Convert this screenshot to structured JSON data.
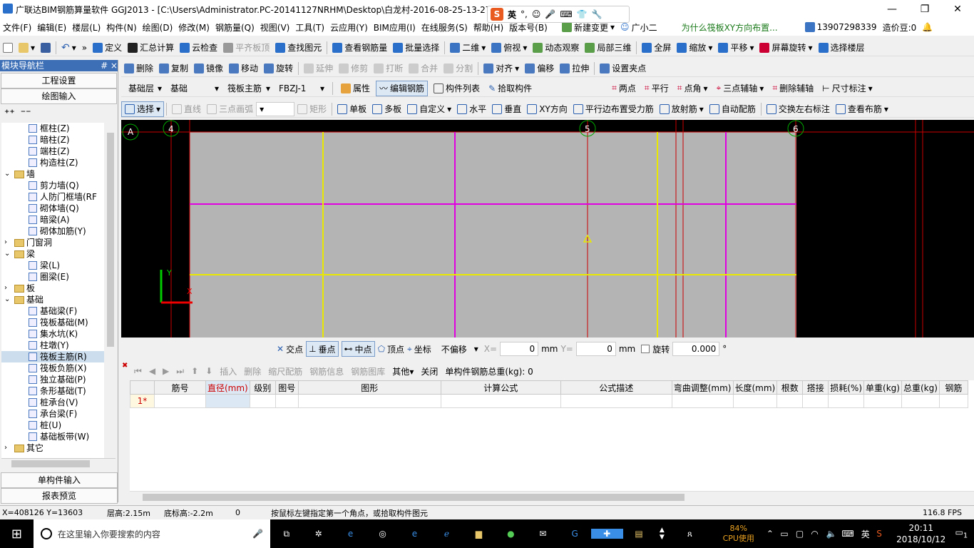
{
  "title": "广联达BIM钢筋算量软件 GGJ2013 - [C:\\Users\\Administrator.PC-20141127NRHM\\Desktop\\白龙村-2016-08-25-13-27",
  "ime": {
    "lang": "英"
  },
  "menu": [
    "文件(F)",
    "编辑(E)",
    "楼层(L)",
    "构件(N)",
    "绘图(D)",
    "修改(M)",
    "钢筋量(Q)",
    "视图(V)",
    "工具(T)",
    "云应用(Y)",
    "BIM应用(I)",
    "在线服务(S)",
    "帮助(H)",
    "版本号(B)"
  ],
  "menu_right": {
    "new_change": "新建变更",
    "assistant": "广小二",
    "question": "为什么筏板XY方向布置...",
    "phone": "13907298339",
    "cost": "造价豆:0"
  },
  "tb1": [
    "定义",
    "汇总计算",
    "云检查",
    "平齐板顶",
    "查找图元",
    "查看钢筋量",
    "批量选择",
    "二维",
    "俯视",
    "动态观察",
    "局部三维",
    "全屏",
    "缩放",
    "平移",
    "屏幕旋转",
    "选择楼层"
  ],
  "tb2": [
    "删除",
    "复制",
    "镜像",
    "移动",
    "旋转",
    "延伸",
    "修剪",
    "打断",
    "合并",
    "分割",
    "对齐",
    "偏移",
    "拉伸",
    "设置夹点"
  ],
  "tb3": {
    "floor": "基础层",
    "category": "基础",
    "type": "筏板主筋",
    "name": "FBZJ-1",
    "props": "属性",
    "edit": "编辑钢筋",
    "list": "构件列表",
    "pick": "拾取构件",
    "twopt": "两点",
    "parallel": "平行",
    "angle": "点角",
    "threept": "三点辅轴",
    "delaxis": "删除辅轴",
    "dim": "尺寸标注"
  },
  "tb4": [
    "选择",
    "直线",
    "三点画弧",
    "矩形",
    "单板",
    "多板",
    "自定义",
    "水平",
    "垂直",
    "XY方向",
    "平行边布置受力筋",
    "放射筋",
    "自动配筋",
    "交换左右标注",
    "查看布筋"
  ],
  "nav": {
    "head": "模块导航栏",
    "pin": "# ×",
    "setup": "工程设置",
    "draw": "绘图输入",
    "single": "单构件输入",
    "report": "报表预览"
  },
  "tree": [
    {
      "t": "框柱(Z)",
      "k": "leaf",
      "l": 2
    },
    {
      "t": "暗柱(Z)",
      "k": "leaf",
      "l": 2
    },
    {
      "t": "端柱(Z)",
      "k": "leaf",
      "l": 2
    },
    {
      "t": "构造柱(Z)",
      "k": "leaf",
      "l": 2
    },
    {
      "t": "墙",
      "k": "folder",
      "l": 1,
      "e": "v"
    },
    {
      "t": "剪力墙(Q)",
      "k": "leaf",
      "l": 2
    },
    {
      "t": "人防门框墙(RF",
      "k": "leaf",
      "l": 2
    },
    {
      "t": "砌体墙(Q)",
      "k": "leaf",
      "l": 2
    },
    {
      "t": "暗梁(A)",
      "k": "leaf",
      "l": 2
    },
    {
      "t": "砌体加筋(Y)",
      "k": "leaf",
      "l": 2
    },
    {
      "t": "门窗洞",
      "k": "folder",
      "l": 1,
      "e": ">"
    },
    {
      "t": "梁",
      "k": "folder",
      "l": 1,
      "e": "v"
    },
    {
      "t": "梁(L)",
      "k": "leaf",
      "l": 2
    },
    {
      "t": "圈梁(E)",
      "k": "leaf",
      "l": 2
    },
    {
      "t": "板",
      "k": "folder",
      "l": 1,
      "e": ">"
    },
    {
      "t": "基础",
      "k": "folder",
      "l": 1,
      "e": "v"
    },
    {
      "t": "基础梁(F)",
      "k": "leaf",
      "l": 2
    },
    {
      "t": "筏板基础(M)",
      "k": "leaf",
      "l": 2
    },
    {
      "t": "集水坑(K)",
      "k": "leaf",
      "l": 2
    },
    {
      "t": "柱墩(Y)",
      "k": "leaf",
      "l": 2
    },
    {
      "t": "筏板主筋(R)",
      "k": "leaf",
      "l": 2,
      "s": 1
    },
    {
      "t": "筏板负筋(X)",
      "k": "leaf",
      "l": 2
    },
    {
      "t": "独立基础(P)",
      "k": "leaf",
      "l": 2
    },
    {
      "t": "条形基础(T)",
      "k": "leaf",
      "l": 2
    },
    {
      "t": "桩承台(V)",
      "k": "leaf",
      "l": 2
    },
    {
      "t": "承台梁(F)",
      "k": "leaf",
      "l": 2
    },
    {
      "t": "桩(U)",
      "k": "leaf",
      "l": 2
    },
    {
      "t": "基础板带(W)",
      "k": "leaf",
      "l": 2
    },
    {
      "t": "其它",
      "k": "folder",
      "l": 1,
      "e": ">"
    }
  ],
  "axes": {
    "a": "A",
    "n4": "4",
    "n5": "5",
    "n6": "6",
    "y": "Y",
    "x": "X"
  },
  "snap": {
    "cross": "交点",
    "perp": "垂点",
    "mid": "中点",
    "vertex": "顶点",
    "coord": "坐标",
    "offset": "不偏移",
    "x_label": "X=",
    "x": "0",
    "y_label": "Y=",
    "y": "0",
    "mm": "mm",
    "rotate": "旋转",
    "angle": "0.000",
    "deg": "°"
  },
  "gridtb": [
    "插入",
    "删除",
    "缩尺配筋",
    "钢筋信息",
    "钢筋图库",
    "其他",
    "关闭"
  ],
  "gridtotal": "单构件钢筋总重(kg): 0",
  "columns": [
    "筋号",
    "直径(mm)",
    "级别",
    "图号",
    "图形",
    "计算公式",
    "公式描述",
    "弯曲调整(mm)",
    "长度(mm)",
    "根数",
    "搭接",
    "损耗(%)",
    "单重(kg)",
    "总重(kg)",
    "钢筋"
  ],
  "row1": "1*",
  "status": {
    "xy": "X=408126 Y=13603",
    "floor": "层高:2.15m",
    "bottom": "底标高:-2.2m",
    "zero": "0",
    "hint": "按鼠标左键指定第一个角点，或拾取构件图元",
    "fps": "116.8 FPS"
  },
  "taskbar": {
    "search": "在这里输入你要搜索的内容",
    "cpu": "84%",
    "cpu_label": "CPU使用",
    "lang": "英",
    "time": "20:11",
    "date": "2018/10/12",
    "notif": "1"
  }
}
